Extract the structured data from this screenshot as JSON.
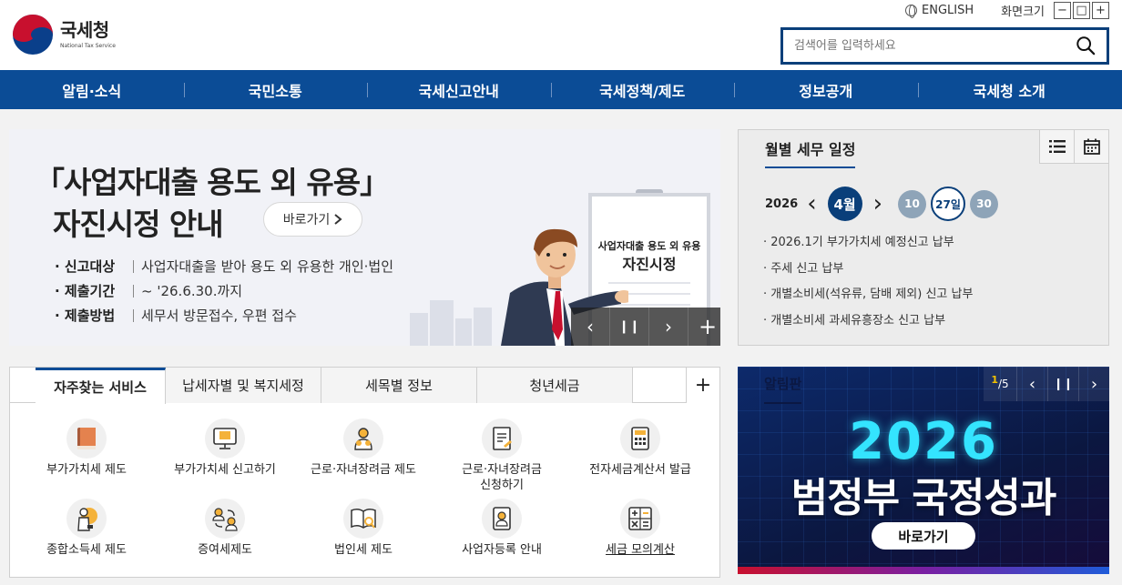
{
  "header": {
    "logo_kr": "국세청",
    "logo_en": "National Tax Service",
    "english_label": "ENGLISH",
    "fontsize_label": "화면크기",
    "fs_minus": "−",
    "fs_reset": "□",
    "fs_plus": "+",
    "search_placeholder": "검색어를 입력하세요"
  },
  "nav": [
    {
      "label": "알림·소식"
    },
    {
      "label": "국민소통"
    },
    {
      "label": "국세신고안내"
    },
    {
      "label": "국세정책/제도"
    },
    {
      "label": "정보공개"
    },
    {
      "label": "국세청 소개"
    }
  ],
  "banner": {
    "title1": "「사업자대출 용도 외 유용」",
    "title2": "자진시정 안내",
    "button": "바로가기",
    "button_icon": "chevron-right",
    "rows": [
      {
        "key": "신고대상",
        "value": "사업자대출을 받아 용도 외 유용한 개인·법인"
      },
      {
        "key": "제출기간",
        "value": "~ '26.6.30.까지"
      },
      {
        "key": "제출방법",
        "value": "세무서 방문접수, 우편 접수"
      }
    ],
    "board_small": "사업자대출 용도 외 유용",
    "board_big": "자진시정",
    "controls": {
      "prev": "‹",
      "pause": "❙❙",
      "next": "›",
      "more": "+"
    }
  },
  "schedule": {
    "title": "월별 세무 일정",
    "year": "2026",
    "month": "4월",
    "prev": "‹",
    "next": "›",
    "days": [
      {
        "label": "10",
        "selected": false
      },
      {
        "label": "27일",
        "selected": true
      },
      {
        "label": "30",
        "selected": false
      }
    ],
    "items": [
      "2026.1기 부가가치세 예정신고 납부",
      "주세 신고 납부",
      "개별소비세(석유류, 담배 제외) 신고 납부",
      "개별소비세 과세유흥장소 신고 납부"
    ]
  },
  "services": {
    "tabs": [
      {
        "label": "자주찾는 서비스",
        "active": true
      },
      {
        "label": "납세자별 및 복지세정",
        "active": false
      },
      {
        "label": "세목별 정보",
        "active": false
      },
      {
        "label": "청년세금",
        "active": false
      }
    ],
    "plus": "+",
    "items": [
      {
        "label": "부가가치세 제도",
        "icon": "book-icon",
        "link": false
      },
      {
        "label": "부가가치세 신고하기",
        "icon": "monitor-icon",
        "link": false
      },
      {
        "label": "근로·자녀장려금 제도",
        "icon": "family-icon",
        "link": false
      },
      {
        "label": "근로·자녀장려금\n신청하기",
        "icon": "document-icon",
        "link": false
      },
      {
        "label": "전자세금계산서 발급",
        "icon": "calculator-icon",
        "link": false
      },
      {
        "label": "종합소득세 제도",
        "icon": "person-bulb-icon",
        "link": false
      },
      {
        "label": "증여세제도",
        "icon": "exchange-icon",
        "link": false
      },
      {
        "label": "법인세 제도",
        "icon": "open-book-icon",
        "link": false
      },
      {
        "label": "사업자등록 안내",
        "icon": "badge-icon",
        "link": false
      },
      {
        "label": "세금 모의계산",
        "icon": "math-icon",
        "link": true
      }
    ]
  },
  "notice": {
    "title": "알림판",
    "page_current": "1",
    "page_total": "/5",
    "year": "2026",
    "main": "범정부 국정성과",
    "button": "바로가기",
    "controls": {
      "prev": "‹",
      "pause": "❙❙",
      "next": "›"
    }
  },
  "colors": {
    "nav_bg": "#0b4c96",
    "primary_dark": "#0a3f7a",
    "notice_cyan": "#34e4ff"
  }
}
